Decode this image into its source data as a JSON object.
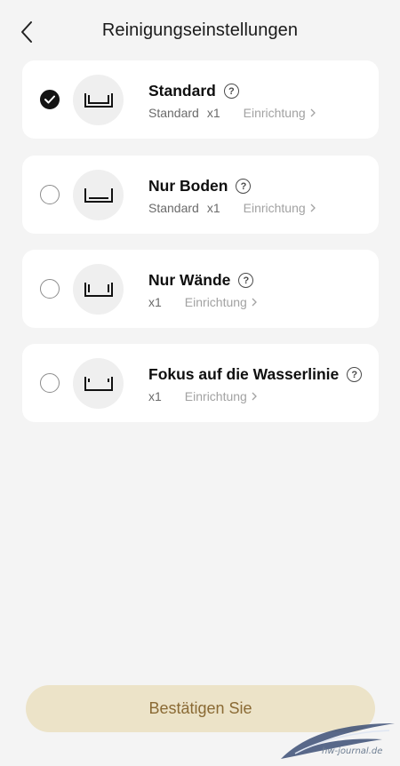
{
  "header": {
    "title": "Reinigungseinstellungen",
    "back_icon": "chevron-left-icon"
  },
  "modes": [
    {
      "title": "Standard",
      "subtitle": "Standard",
      "count": "x1",
      "link": "Einrichtung",
      "selected": true,
      "icon": "pool-floor-walls-icon"
    },
    {
      "title": "Nur Boden",
      "subtitle": "Standard",
      "count": "x1",
      "link": "Einrichtung",
      "selected": false,
      "icon": "pool-floor-icon"
    },
    {
      "title": "Nur Wände",
      "subtitle": "",
      "count": "x1",
      "link": "Einrichtung",
      "selected": false,
      "icon": "pool-walls-icon"
    },
    {
      "title": "Fokus auf die Wasserlinie",
      "subtitle": "",
      "count": "x1",
      "link": "Einrichtung",
      "selected": false,
      "icon": "pool-waterline-icon"
    }
  ],
  "confirm": {
    "label": "Bestätigen Sie"
  },
  "watermark": {
    "text": "hw-journal.de"
  },
  "colors": {
    "background": "#f4f4f4",
    "card": "#ffffff",
    "confirm_bg": "#ece3c8",
    "confirm_text": "#8a6a34",
    "link": "#a2a2a2"
  }
}
